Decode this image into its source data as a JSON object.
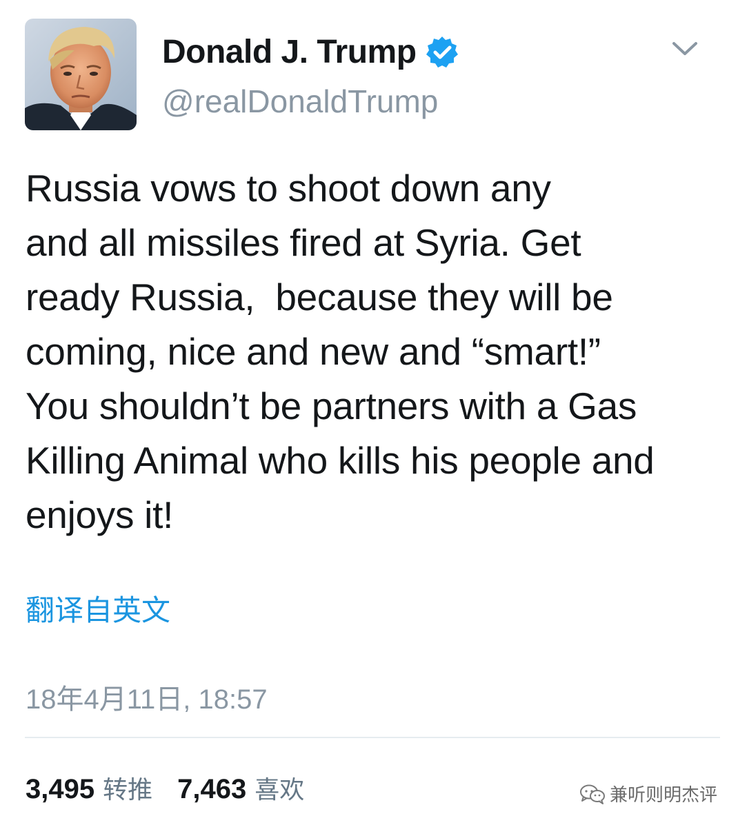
{
  "profile": {
    "display_name": "Donald J. Trump",
    "handle": "@realDonaldTrump",
    "verified": true,
    "verified_color": "#1da1f2"
  },
  "tweet": {
    "lines": [
      "Russia vows to shoot down any",
      "and all missiles fired at Syria. Get",
      "ready Russia,  because they will be",
      "coming, nice and new and “smart!”",
      "You shouldn’t be partners with a Gas",
      "Killing Animal who kills his people and",
      "enjoys it!"
    ],
    "translate_label": "翻译自英文",
    "timestamp": "18年4月11日, 18:57"
  },
  "stats": {
    "retweets_count": "3,495",
    "retweets_label": "转推",
    "likes_count": "7,463",
    "likes_label": "喜欢"
  },
  "watermark": {
    "text": "兼听则明杰评",
    "icon": "wechat-icon"
  },
  "colors": {
    "link": "#1b95e0",
    "secondary_text": "#8a97a3",
    "primary_text": "#14171a"
  }
}
